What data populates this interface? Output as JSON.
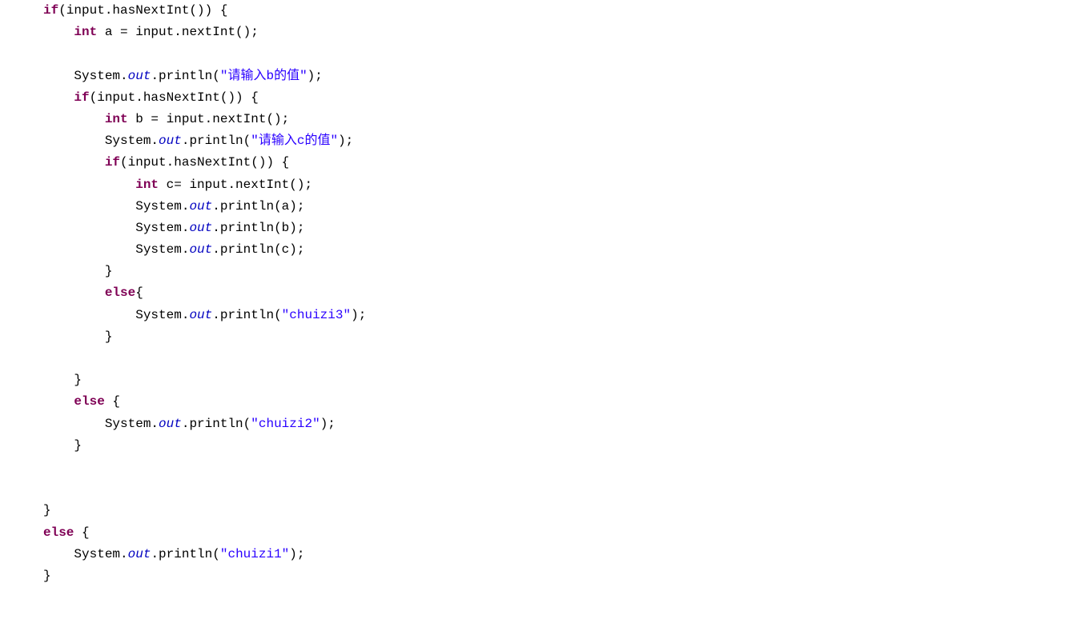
{
  "code": {
    "tokens": [
      [
        "kw",
        "if"
      ],
      [
        "plain",
        "(input.hasNextInt()) {\n    "
      ],
      [
        "kw",
        "int"
      ],
      [
        "plain",
        " a = input.nextInt();\n\n    System."
      ],
      [
        "field",
        "out"
      ],
      [
        "plain",
        ".println("
      ],
      [
        "str",
        "\"请输入b的值\""
      ],
      [
        "plain",
        ");\n    "
      ],
      [
        "kw",
        "if"
      ],
      [
        "plain",
        "(input.hasNextInt()) {\n        "
      ],
      [
        "kw",
        "int"
      ],
      [
        "plain",
        " b = input.nextInt();\n        System."
      ],
      [
        "field",
        "out"
      ],
      [
        "plain",
        ".println("
      ],
      [
        "str",
        "\"请输入c的值\""
      ],
      [
        "plain",
        ");\n        "
      ],
      [
        "kw",
        "if"
      ],
      [
        "plain",
        "(input.hasNextInt()) {\n            "
      ],
      [
        "kw",
        "int"
      ],
      [
        "plain",
        " c= input.nextInt();\n            System."
      ],
      [
        "field",
        "out"
      ],
      [
        "plain",
        ".println(a);\n            System."
      ],
      [
        "field",
        "out"
      ],
      [
        "plain",
        ".println(b);\n            System."
      ],
      [
        "field",
        "out"
      ],
      [
        "plain",
        ".println(c);\n        }\n        "
      ],
      [
        "kw",
        "else"
      ],
      [
        "plain",
        "{\n            System."
      ],
      [
        "field",
        "out"
      ],
      [
        "plain",
        ".println("
      ],
      [
        "str",
        "\"chuizi3\""
      ],
      [
        "plain",
        ");\n        }\n\n    }\n    "
      ],
      [
        "kw",
        "else"
      ],
      [
        "plain",
        " {\n        System."
      ],
      [
        "field",
        "out"
      ],
      [
        "plain",
        ".println("
      ],
      [
        "str",
        "\"chuizi2\""
      ],
      [
        "plain",
        ");\n    }\n\n\n}\n"
      ],
      [
        "kw",
        "else"
      ],
      [
        "plain",
        " {\n    System."
      ],
      [
        "field",
        "out"
      ],
      [
        "plain",
        ".println("
      ],
      [
        "str",
        "\"chuizi1\""
      ],
      [
        "plain",
        ");\n}"
      ]
    ]
  }
}
